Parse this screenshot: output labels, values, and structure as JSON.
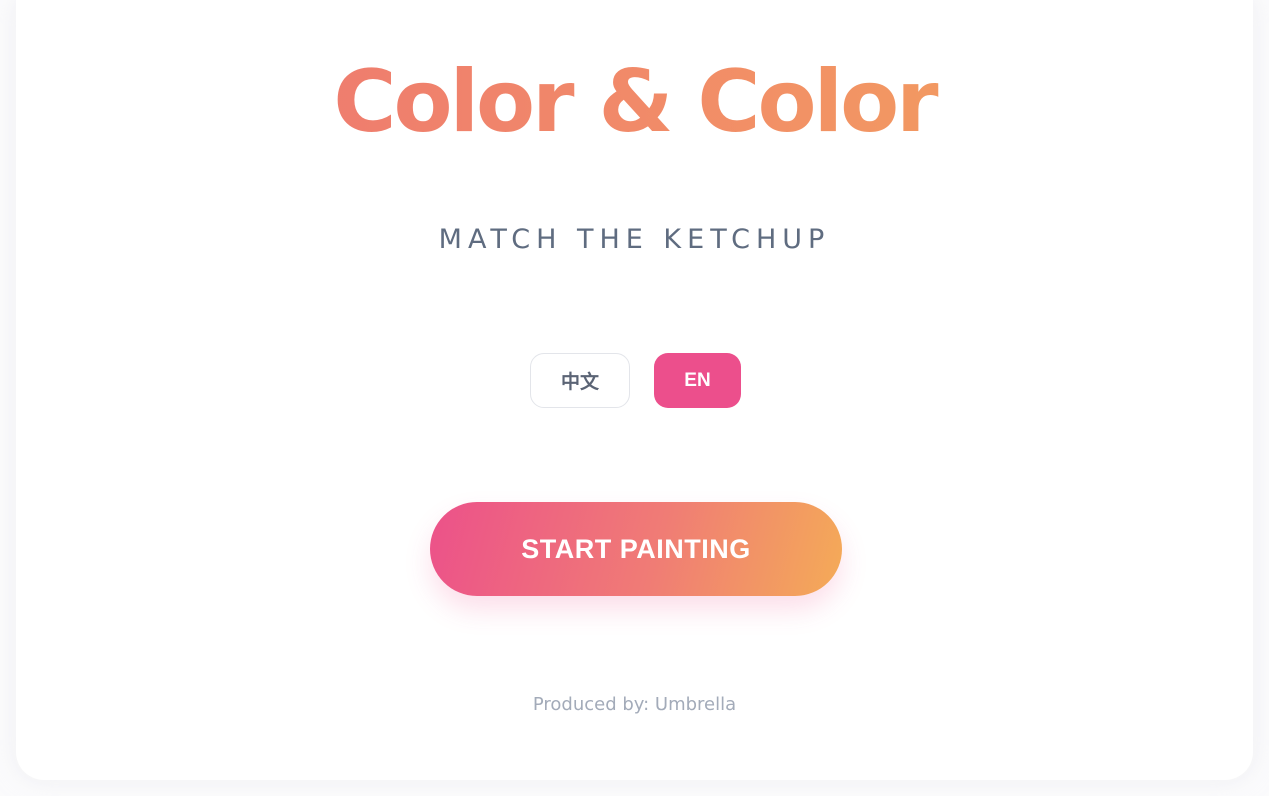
{
  "app": {
    "title": "Color & Color",
    "subtitle": "MATCH THE KETCHUP"
  },
  "language": {
    "options": [
      {
        "label": "中文",
        "selected": false
      },
      {
        "label": "EN",
        "selected": true
      }
    ]
  },
  "actions": {
    "start_label": "START PAINTING"
  },
  "footer": {
    "credit": "Produced by: Umbrella"
  },
  "colors": {
    "title_gradient_start": "#ec6f73",
    "title_gradient_end": "#f4a85a",
    "accent_pink": "#ec4f8c",
    "button_gradient_end": "#f4ab57",
    "subtitle_text": "#5f6c80",
    "muted_text": "#a3abb9"
  }
}
